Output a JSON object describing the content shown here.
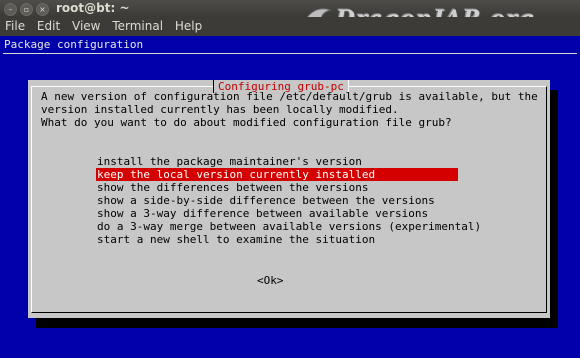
{
  "window": {
    "title": "root@bt: ~",
    "min_glyph": "–",
    "max_glyph": "▫",
    "close_glyph": "×"
  },
  "watermark": {
    "text": "DragonJAR.org"
  },
  "menu": [
    "File",
    "Edit",
    "View",
    "Terminal",
    "Help"
  ],
  "terminal": {
    "header": "Package configuration",
    "background": "#0000aa"
  },
  "dialog": {
    "title": "Configuring grub-pc",
    "message_lines": [
      "A new version of configuration file /etc/default/grub is available, but the",
      "version installed currently has been locally modified.",
      "",
      "What do you want to do about modified configuration file grub?"
    ],
    "options": [
      "install the package maintainer's version",
      "keep the local version currently installed",
      "show the differences between the versions",
      "show a side-by-side difference between the versions",
      "show a 3-way difference between available versions",
      "do a 3-way merge between available versions (experimental)",
      "start a new shell to examine the situation"
    ],
    "selected_index": 1,
    "ok_label": "<Ok>",
    "title_color": "#c00000",
    "selection_color": "#d40000"
  }
}
